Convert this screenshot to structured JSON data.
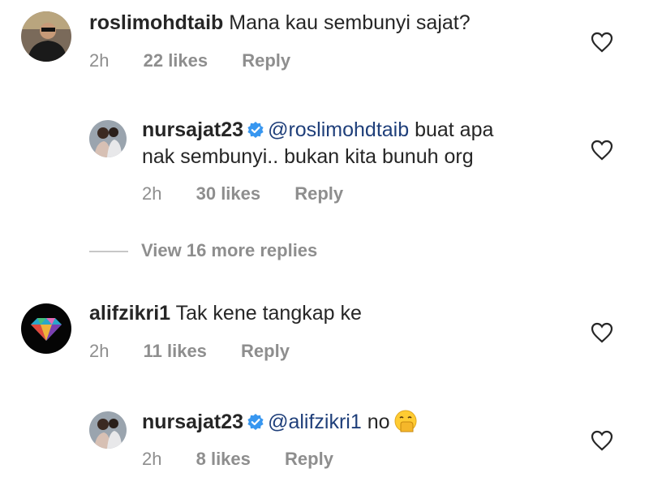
{
  "comments": [
    {
      "username": "roslimohdtaib",
      "text": "Mana kau sembunyi sajat?",
      "time": "2h",
      "likes": "22 likes",
      "reply": "Reply"
    },
    {
      "username": "nursajat23",
      "mention": "@roslimohdtaib",
      "text_line1": " buat apa",
      "text_line2": "nak sembunyi.. bukan kita bunuh org",
      "time": "2h",
      "likes": "30 likes",
      "reply": "Reply"
    },
    {
      "view_more": "View 16 more replies"
    },
    {
      "username": "alifzikri1",
      "text": "Tak kene tangkap ke",
      "time": "2h",
      "likes": "11 likes",
      "reply": "Reply"
    },
    {
      "username": "nursajat23",
      "mention": "@alifzikri1",
      "text": " no",
      "emoji": "face-with-hand-over-mouth",
      "time": "2h",
      "likes": "8 likes",
      "reply": "Reply"
    }
  ],
  "colors": {
    "text": "#262626",
    "meta": "#8e8e8e",
    "mention": "#1f3f7a",
    "verified": "#3897f0"
  },
  "icons": [
    "heart-icon",
    "verified-badge-icon"
  ]
}
